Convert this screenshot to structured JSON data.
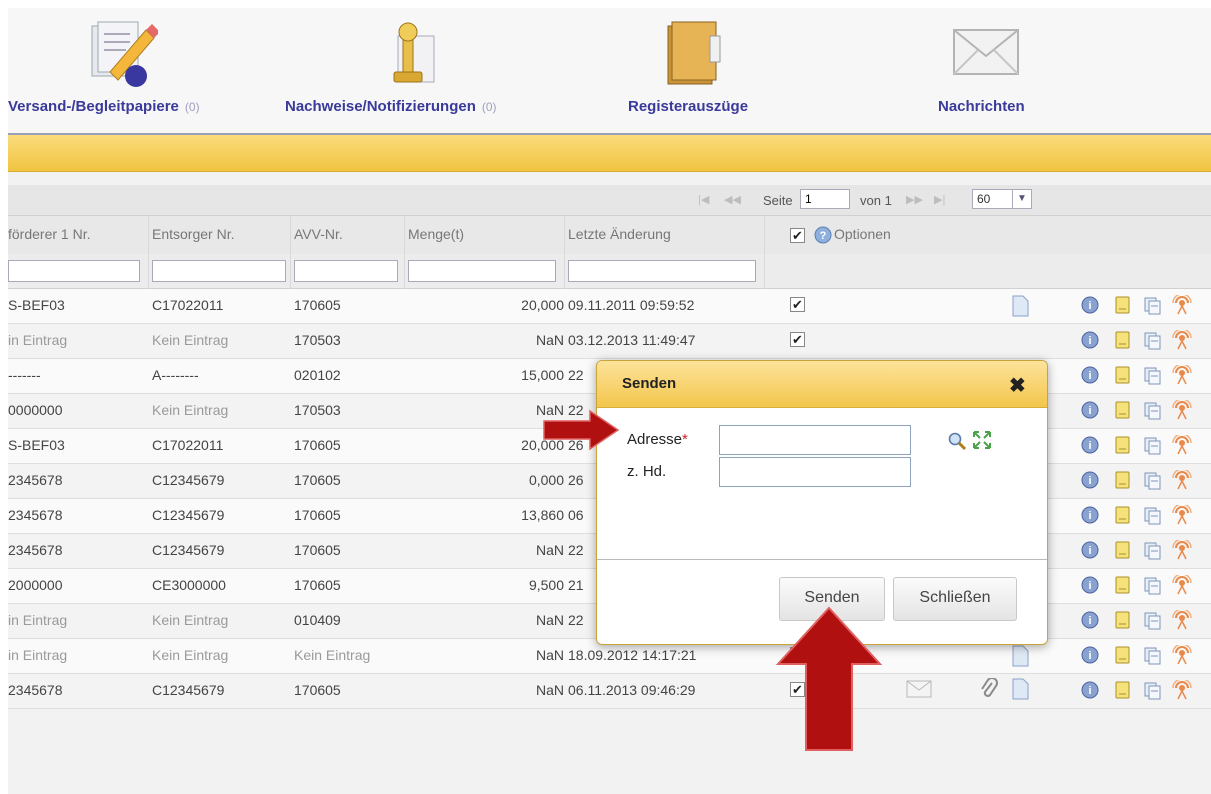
{
  "nav": {
    "items": [
      {
        "label": "Versand-/Begleitpapiere",
        "count": "(0)"
      },
      {
        "label": "Nachweise/Notifizierungen",
        "count": "(0)"
      },
      {
        "label": "Registerauszüge",
        "count": ""
      },
      {
        "label": "Nachrichten",
        "count": ""
      }
    ]
  },
  "pager": {
    "page_label": "Seite",
    "page_value": "1",
    "of_label": "von 1",
    "per_page": "60"
  },
  "table": {
    "columns": [
      "förderer 1 Nr.",
      "Entsorger Nr.",
      "AVV-Nr.",
      "Menge(t)",
      "Letzte Änderung"
    ],
    "options_label": "Optionen",
    "rows": [
      [
        "S-BEF03",
        "C17022011",
        "170605",
        "20,000",
        "09.11.2011 09:59:52"
      ],
      [
        "in Eintrag",
        "Kein Eintrag",
        "170503",
        "NaN",
        "03.12.2013 11:49:47"
      ],
      [
        "-------",
        "A--------",
        "020102",
        "15,000",
        "22"
      ],
      [
        "0000000",
        "Kein Eintrag",
        "170503",
        "NaN",
        "22"
      ],
      [
        "S-BEF03",
        "C17022011",
        "170605",
        "20,000",
        "26"
      ],
      [
        "2345678",
        "C12345679",
        "170605",
        "0,000",
        "26"
      ],
      [
        "2345678",
        "C12345679",
        "170605",
        "13,860",
        "06"
      ],
      [
        "2345678",
        "C12345679",
        "170605",
        "NaN",
        "22"
      ],
      [
        "2000000",
        "CE3000000",
        "170605",
        "9,500",
        "21"
      ],
      [
        "in Eintrag",
        "Kein Eintrag",
        "010409",
        "NaN",
        "22"
      ],
      [
        "in Eintrag",
        "Kein Eintrag",
        "Kein Eintrag",
        "NaN",
        "18.09.2012 14:17:21"
      ],
      [
        "2345678",
        "C12345679",
        "170605",
        "NaN",
        "06.11.2013 09:46:29"
      ]
    ]
  },
  "dialog": {
    "title": "Senden",
    "address_label": "Adresse",
    "required_mark": "*",
    "attn_label": "z. Hd.",
    "address_value": "",
    "attn_value": "",
    "send_button": "Senden",
    "close_button": "Schließen"
  },
  "colors": {
    "accent_yellow": "#f1c441",
    "nav_text": "#3a3a9a",
    "arrow_red": "#b01010"
  }
}
